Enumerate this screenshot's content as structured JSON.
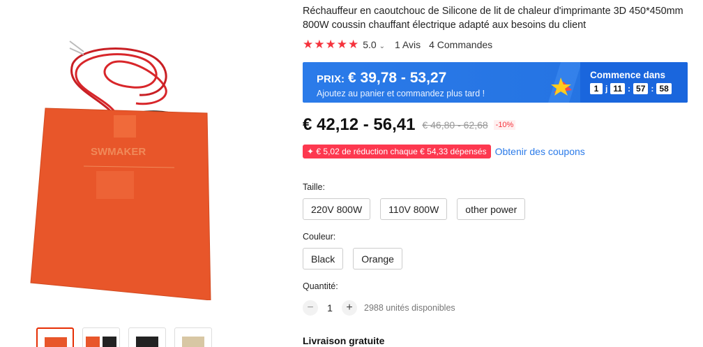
{
  "product": {
    "title": "Réchauffeur en caoutchouc de Silicone de lit de chaleur d'imprimante 3D 450*450mm 800W coussin chauffant électrique adapté aux besoins du client",
    "image_brand_text": "SWMAKER",
    "rating": {
      "value": "5.0",
      "chevron": "⌄",
      "stars": 5,
      "reviews": "1 Avis",
      "orders": "4 Commandes"
    }
  },
  "promo": {
    "label": "PRIX:",
    "price": "€ 39,78 - 53,27",
    "subtitle": "Ajoutez au panier et commandez plus tard !",
    "countdown_label": "Commence dans",
    "countdown": {
      "days": "1",
      "days_unit": "j",
      "hours": "11",
      "minutes": "57",
      "seconds": "58"
    }
  },
  "pricing": {
    "current": "€ 42,12 - 56,41",
    "original": "€ 46,80 - 62,68",
    "discount": "-10%"
  },
  "coupon": {
    "badge": "✦ € 5,02 de réduction chaque € 54,33 dépensés",
    "link": "Obtenir des coupons"
  },
  "options": {
    "size_label": "Taille:",
    "sizes": [
      "220V 800W",
      "110V 800W",
      "other power"
    ],
    "color_label": "Couleur:",
    "colors": [
      "Black",
      "Orange"
    ]
  },
  "quantity": {
    "label": "Quantité:",
    "minus": "−",
    "value": "1",
    "plus": "+",
    "available": "2988 unités disponibles"
  },
  "shipping": {
    "label": "Livraison gratuite"
  },
  "colors": {
    "accent_red": "#f5323c",
    "promo_blue": "#2371e0",
    "coupon_pink": "#fd384f",
    "link_blue": "#2b7be9",
    "pad_orange": "#e8562a"
  }
}
